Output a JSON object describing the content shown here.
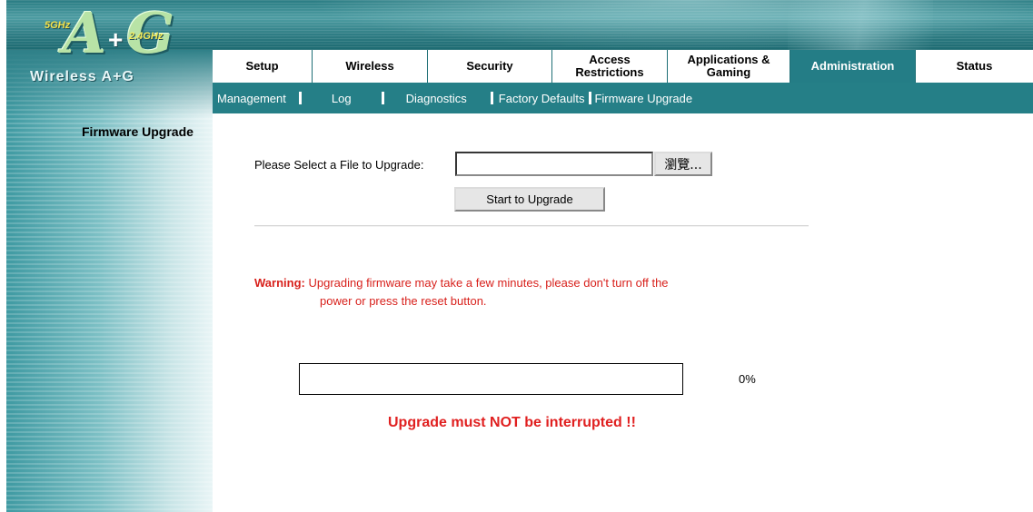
{
  "brand": {
    "logo_band_5ghz": "5GHz",
    "logo_band_24ghz": "2.4GHz",
    "logo_letters": "A",
    "logo_letter_g": "G",
    "logo_plus": "+",
    "product_name": "Wireless A+G"
  },
  "nav": {
    "tabs": [
      {
        "label": "Setup",
        "active": false
      },
      {
        "label": "Wireless",
        "active": false
      },
      {
        "label": "Security",
        "active": false
      },
      {
        "label": "Access Restrictions",
        "line1": "Access",
        "line2": "Restrictions",
        "active": false
      },
      {
        "label": "Applications & Gaming",
        "line1": "Applications &",
        "line2": "Gaming",
        "active": false
      },
      {
        "label": "Administration",
        "active": true
      },
      {
        "label": "Status",
        "active": false
      }
    ],
    "subtabs": [
      {
        "label": "Management"
      },
      {
        "label": "Log"
      },
      {
        "label": "Diagnostics"
      },
      {
        "label": "Factory Defaults"
      },
      {
        "label": "Firmware Upgrade"
      }
    ]
  },
  "page": {
    "section_title": "Firmware Upgrade",
    "file_label": "Please Select a File to Upgrade:",
    "file_value": "",
    "browse_label": "瀏覽...",
    "upgrade_button": "Start to Upgrade",
    "warning_label": "Warning:",
    "warning_line1": "Upgrading firmware may take a few minutes, please don't turn off the",
    "warning_line2": "power or press the reset button.",
    "progress_percent": 0,
    "progress_text": "0%",
    "interrupt_warning": "Upgrade must NOT be interrupted !!"
  },
  "colors": {
    "accent": "#247d86",
    "warning": "#d8211c"
  }
}
